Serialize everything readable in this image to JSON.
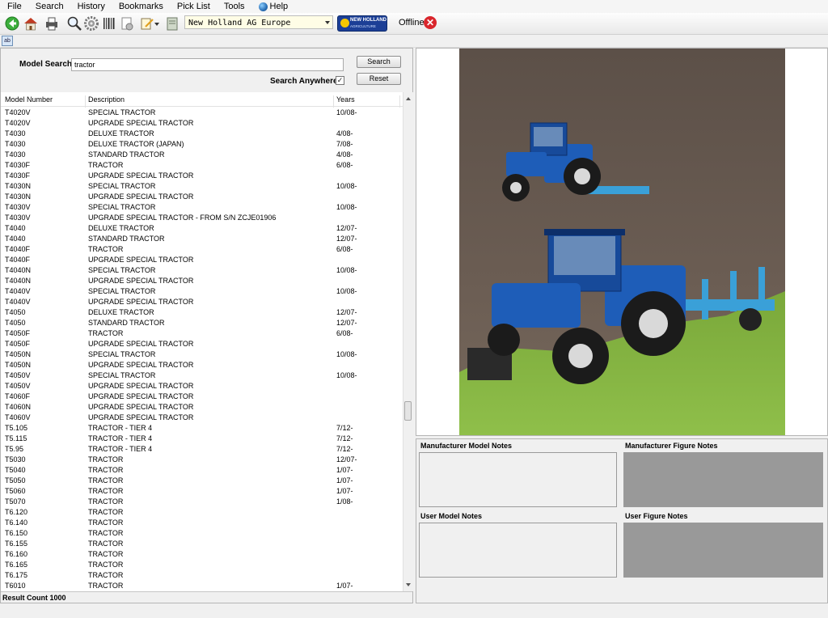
{
  "menu": {
    "items": [
      "File",
      "Search",
      "History",
      "Bookmarks",
      "Pick List",
      "Tools"
    ],
    "help": "Help"
  },
  "toolbar": {
    "icons": [
      "back-icon",
      "home-icon",
      "print-icon",
      "zoom-icon",
      "settings-gear-icon",
      "barcode-icon",
      "page-setup-icon",
      "edit-note-icon",
      "notebook-icon"
    ],
    "region": "New Holland AG Europe",
    "brand_line1": "NEW HOLLAND",
    "brand_line2": "AGRICULTURE",
    "status": "Offline"
  },
  "search": {
    "label": "Model Search",
    "value": "tractor",
    "search_button": "Search",
    "reset_button": "Reset",
    "anywhere_label": "Search Anywhere",
    "anywhere_checked": true
  },
  "list": {
    "columns": [
      "Model Number",
      "Description",
      "Years"
    ],
    "rows": [
      [
        "T4020V",
        "SPECIAL TRACTOR",
        "10/08-"
      ],
      [
        "T4020V",
        "UPGRADE SPECIAL TRACTOR",
        ""
      ],
      [
        "T4030",
        "DELUXE TRACTOR",
        "4/08-"
      ],
      [
        "T4030",
        "DELUXE TRACTOR (JAPAN)",
        "7/08-"
      ],
      [
        "T4030",
        "STANDARD TRACTOR",
        "4/08-"
      ],
      [
        "T4030F",
        "TRACTOR",
        "6/08-"
      ],
      [
        "T4030F",
        "UPGRADE SPECIAL TRACTOR",
        ""
      ],
      [
        "T4030N",
        "SPECIAL TRACTOR",
        "10/08-"
      ],
      [
        "T4030N",
        "UPGRADE SPECIAL TRACTOR",
        ""
      ],
      [
        "T4030V",
        "SPECIAL TRACTOR",
        "10/08-"
      ],
      [
        "T4030V",
        "UPGRADE SPECIAL TRACTOR - FROM S/N ZCJE01906",
        ""
      ],
      [
        "T4040",
        "DELUXE TRACTOR",
        "12/07-"
      ],
      [
        "T4040",
        "STANDARD TRACTOR",
        "12/07-"
      ],
      [
        "T4040F",
        "TRACTOR",
        "6/08-"
      ],
      [
        "T4040F",
        "UPGRADE SPECIAL TRACTOR",
        ""
      ],
      [
        "T4040N",
        "SPECIAL TRACTOR",
        "10/08-"
      ],
      [
        "T4040N",
        "UPGRADE SPECIAL TRACTOR",
        ""
      ],
      [
        "T4040V",
        "SPECIAL TRACTOR",
        "10/08-"
      ],
      [
        "T4040V",
        "UPGRADE SPECIAL TRACTOR",
        ""
      ],
      [
        "T4050",
        "DELUXE TRACTOR",
        "12/07-"
      ],
      [
        "T4050",
        "STANDARD TRACTOR",
        "12/07-"
      ],
      [
        "T4050F",
        "TRACTOR",
        "6/08-"
      ],
      [
        "T4050F",
        "UPGRADE SPECIAL TRACTOR",
        ""
      ],
      [
        "T4050N",
        "SPECIAL TRACTOR",
        "10/08-"
      ],
      [
        "T4050N",
        "UPGRADE SPECIAL TRACTOR",
        ""
      ],
      [
        "T4050V",
        "SPECIAL TRACTOR",
        "10/08-"
      ],
      [
        "T4050V",
        "UPGRADE SPECIAL TRACTOR",
        ""
      ],
      [
        "T4060F",
        "UPGRADE SPECIAL TRACTOR",
        ""
      ],
      [
        "T4060N",
        "UPGRADE SPECIAL TRACTOR",
        ""
      ],
      [
        "T4060V",
        "UPGRADE SPECIAL TRACTOR",
        ""
      ],
      [
        "T5.105",
        "TRACTOR - TIER 4",
        "7/12-"
      ],
      [
        "T5.115",
        "TRACTOR - TIER 4",
        "7/12-"
      ],
      [
        "T5.95",
        "TRACTOR - TIER 4",
        "7/12-"
      ],
      [
        "T5030",
        "TRACTOR",
        "12/07-"
      ],
      [
        "T5040",
        "TRACTOR",
        "1/07-"
      ],
      [
        "T5050",
        "TRACTOR",
        "1/07-"
      ],
      [
        "T5060",
        "TRACTOR",
        "1/07-"
      ],
      [
        "T5070",
        "TRACTOR",
        "1/08-"
      ],
      [
        "T6.120",
        "TRACTOR",
        ""
      ],
      [
        "T6.140",
        "TRACTOR",
        ""
      ],
      [
        "T6.150",
        "TRACTOR",
        ""
      ],
      [
        "T6.155",
        "TRACTOR",
        ""
      ],
      [
        "T6.160",
        "TRACTOR",
        ""
      ],
      [
        "T6.165",
        "TRACTOR",
        ""
      ],
      [
        "T6.175",
        "TRACTOR",
        ""
      ],
      [
        "T6010",
        "TRACTOR",
        "1/07-"
      ]
    ],
    "result_count": "Result Count 1000"
  },
  "notes": {
    "manufacturer_model": "Manufacturer Model Notes",
    "manufacturer_figure": "Manufacturer Figure Notes",
    "user_model": "User Model Notes",
    "user_figure": "User Figure Notes"
  },
  "colors": {
    "accent_blue": "#1c3f96",
    "offline_red": "#d9262c",
    "region_bg": "#fffde6"
  }
}
